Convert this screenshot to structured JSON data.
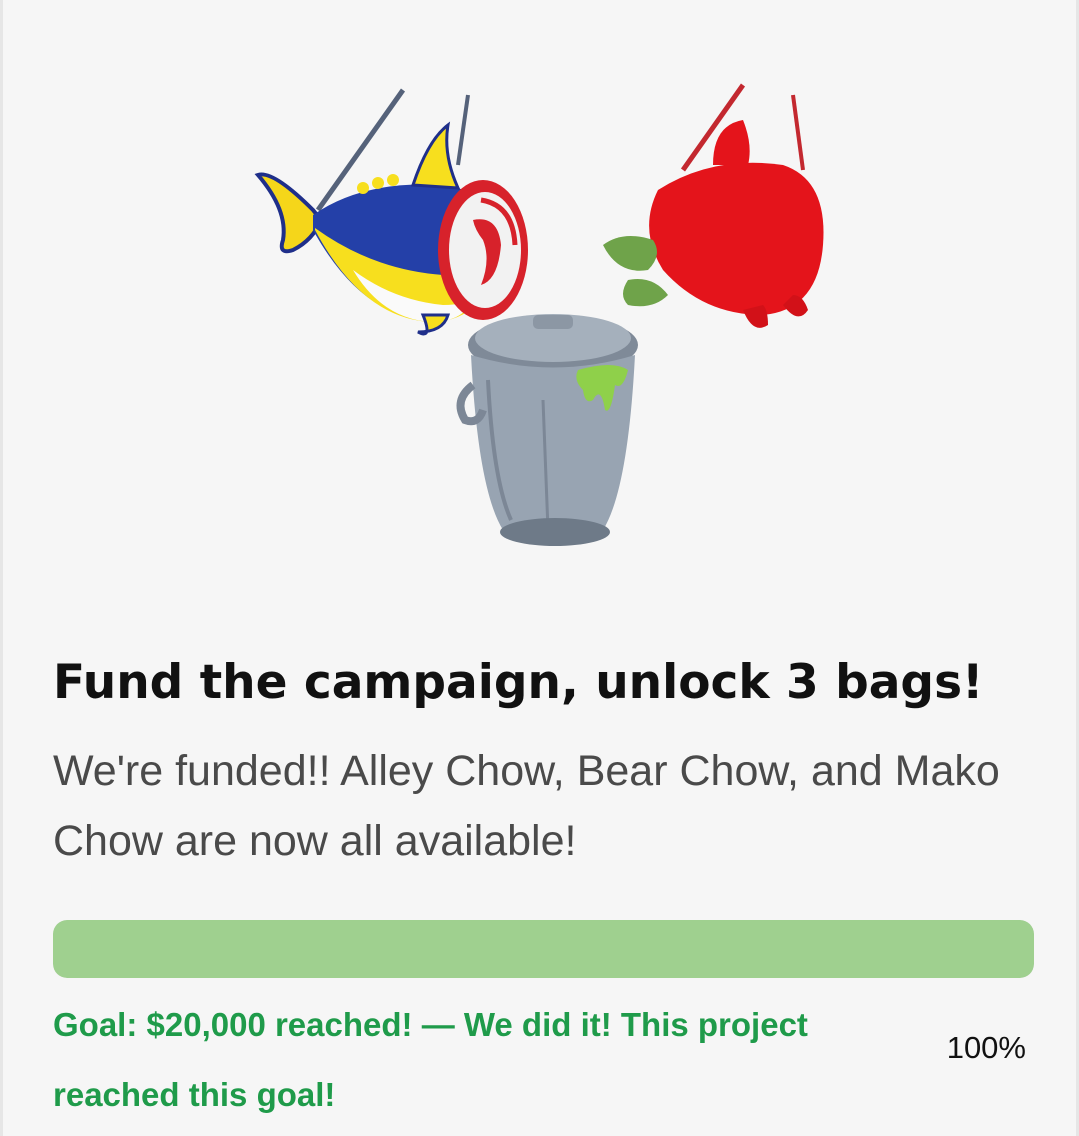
{
  "campaign": {
    "title": "Fund the campaign, unlock 3 bags!",
    "description": "We're funded!! Alley Chow, Bear Chow, and Mako Chow are now all available!",
    "progress": {
      "fraction": 1.0,
      "percent_label": "100%",
      "fill_color": "#9fd08f"
    },
    "goal_text": "Goal: $20,000 reached! — We did it! This project reached this goal!",
    "goal_color": "#1f9b4a"
  },
  "image": {
    "items": [
      "tuna-fish-bag",
      "red-fish-bag",
      "trash-can-bag"
    ]
  }
}
